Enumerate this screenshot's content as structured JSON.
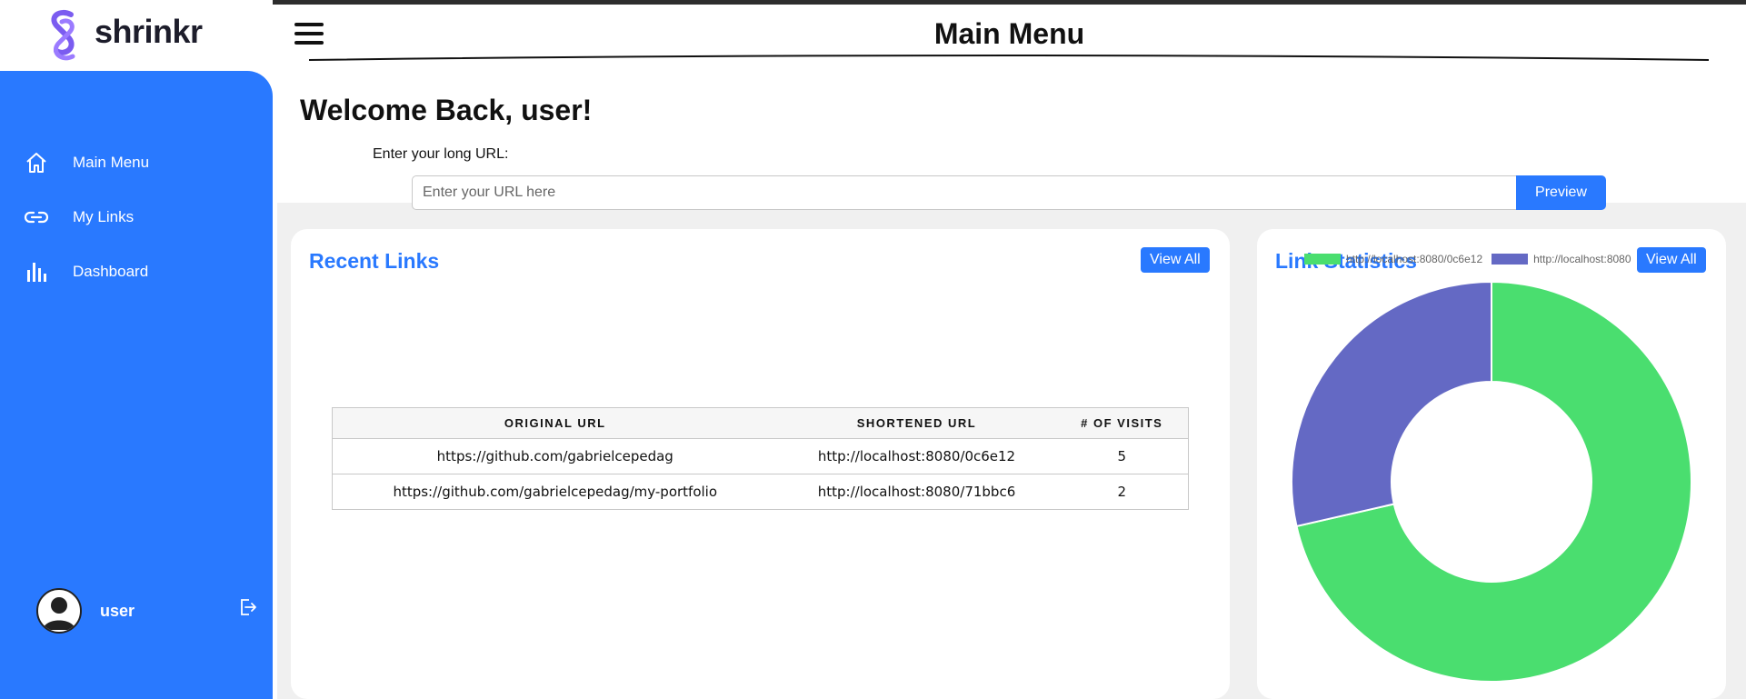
{
  "app": {
    "name": "shrinkr"
  },
  "sidebar": {
    "items": [
      {
        "label": "Main Menu",
        "icon": "home-icon"
      },
      {
        "label": "My Links",
        "icon": "link-icon"
      },
      {
        "label": "Dashboard",
        "icon": "bar-chart-icon"
      }
    ],
    "user": {
      "name": "user"
    }
  },
  "header": {
    "title": "Main Menu"
  },
  "main": {
    "welcome": "Welcome Back, user!",
    "url_label": "Enter your long URL:",
    "url_placeholder": "Enter your URL here",
    "preview_label": "Preview"
  },
  "recent_links": {
    "title": "Recent Links",
    "view_all": "View All",
    "columns": [
      "ORIGINAL URL",
      "SHORTENED URL",
      "# OF VISITS"
    ],
    "rows": [
      {
        "original": "https://github.com/gabrielcepedag",
        "short": "http://localhost:8080/0c6e12",
        "visits": "5"
      },
      {
        "original": "https://github.com/gabrielcepedag/my-portfolio",
        "short": "http://localhost:8080/71bbc6",
        "visits": "2"
      }
    ]
  },
  "link_statistics": {
    "title": "Link Statistics",
    "view_all": "View All",
    "legend": [
      "http://localhost:8080/0c6e12",
      "http://localhost:8080"
    ]
  },
  "chart_data": {
    "type": "pie",
    "categories": [
      "http://localhost:8080/0c6e12",
      "http://localhost:8080/71bbc6"
    ],
    "values": [
      5,
      2
    ],
    "colors": [
      "#4ade6f",
      "#6469c4"
    ],
    "donut": true
  },
  "colors": {
    "accent": "#2979ff",
    "sidebar": "#2979ff"
  }
}
